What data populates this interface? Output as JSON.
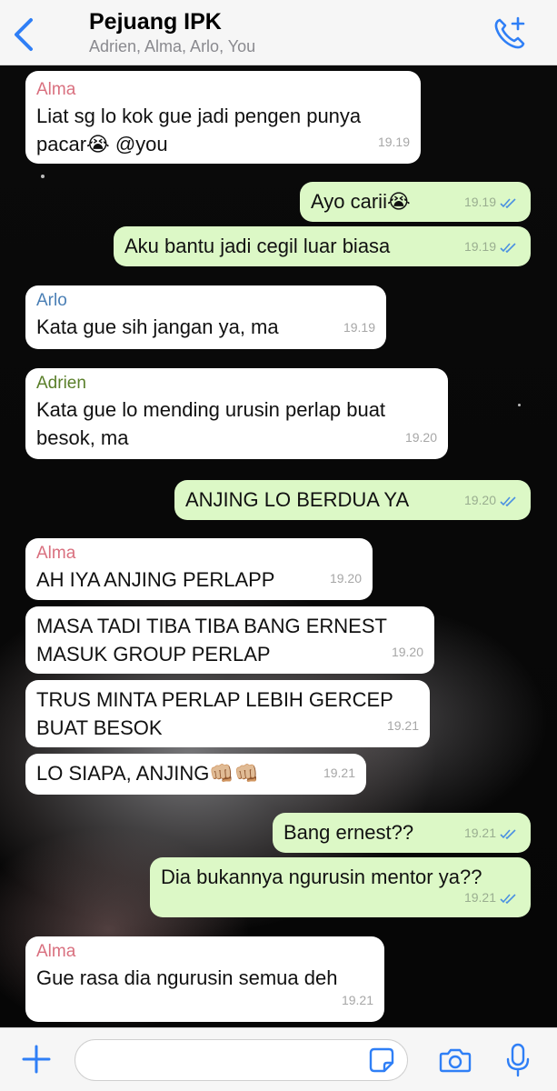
{
  "header": {
    "title": "Pejuang IPK",
    "members": "Adrien, Alma, Arlo, You",
    "back_icon": "chevron-left-icon",
    "call_icon": "add-call-icon",
    "accent": "#2f7ff6"
  },
  "messages": [
    {
      "sender": "Alma",
      "text": "Liat sg lo kok gue jadi pengen punya pacar😭 @you",
      "time": "19.19"
    },
    {
      "text": "Ayo carii😭",
      "time": "19.19"
    },
    {
      "text": "Aku bantu jadi cegil luar biasa",
      "time": "19.19"
    },
    {
      "sender": "Arlo",
      "text": "Kata gue sih jangan ya, ma",
      "time": "19.19"
    },
    {
      "sender": "Adrien",
      "text": "Kata gue lo mending urusin perlap buat besok, ma",
      "time": "19.20"
    },
    {
      "text": "ANJING LO BERDUA YA",
      "time": "19.20"
    },
    {
      "sender": "Alma",
      "text": "AH IYA ANJING PERLAPP",
      "time": "19.20"
    },
    {
      "text": "MASA TADI TIBA TIBA BANG ERNEST MASUK GROUP PERLAP",
      "time": "19.20"
    },
    {
      "text": "TRUS MINTA PERLAP LEBIH GERCEP BUAT BESOK",
      "time": "19.21"
    },
    {
      "text": "LO SIAPA, ANJING👊🏼👊🏼",
      "time": "19.21"
    },
    {
      "text": "Bang ernest??",
      "time": "19.21"
    },
    {
      "text": "Dia bukannya ngurusin mentor ya??",
      "time": "19.21"
    },
    {
      "sender": "Alma",
      "text": "Gue rasa dia ngurusin semua deh",
      "time": "19.21"
    }
  ],
  "sender_colors": {
    "Alma": "#d9707f",
    "Arlo": "#4a7fb5",
    "Adrien": "#5a7f2a"
  },
  "bubble_colors": {
    "incoming": "#ffffff",
    "outgoing": "#dcf8c6"
  },
  "composer": {
    "placeholder": "",
    "icons": [
      "plus-icon",
      "sticker-icon",
      "camera-icon",
      "microphone-icon"
    ]
  }
}
